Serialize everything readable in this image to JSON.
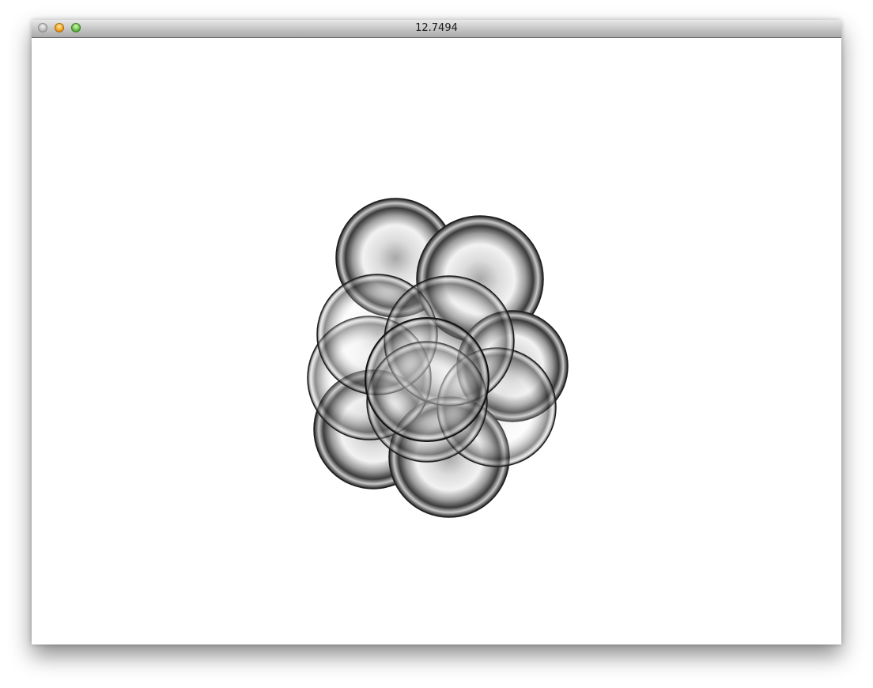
{
  "window": {
    "title": "12.7494"
  },
  "icons": {
    "close": "close-button-icon",
    "minimize": "minimize-button-icon",
    "maximize": "zoom-button-icon"
  },
  "colors": {
    "close_button": "#bcbcbc",
    "minimize_button": "#f5a623",
    "maximize_button": "#6cc24a",
    "bubble_dark": "#2a2a2a",
    "bubble_light": "#e6e6e6"
  }
}
